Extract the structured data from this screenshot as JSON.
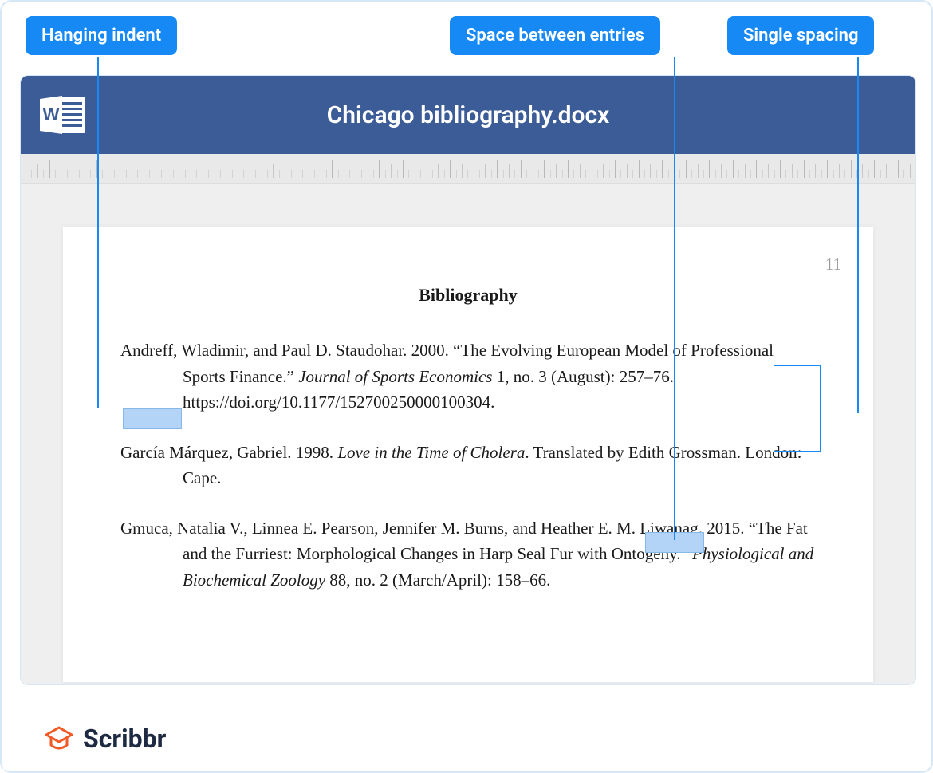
{
  "callouts": {
    "hanging_indent": "Hanging indent",
    "space_between": "Space between entries",
    "single_spacing": "Single spacing"
  },
  "document": {
    "filename": "Chicago bibliography.docx",
    "page_number": "11",
    "heading": "Bibliography",
    "entries": {
      "e1": {
        "p1": "Andreff, Wladimir, and Paul D. Staudohar. 2000. “The Evolving European Model of Professional Sports Finance.” ",
        "journal": "Journal of Sports Economics",
        "p2": " 1, no. 3 (August): 257–76. https://doi.org/10.1177/152700250000100304."
      },
      "e2": {
        "p1": "García Márquez, Gabriel. 1998. ",
        "title": "Love in the Time of Cholera",
        "p2": ". Translated by Edith Grossman. London: Cape."
      },
      "e3": {
        "p1": "Gmuca, Natalia V., Linnea E. Pearson, Jennifer M. Burns, and Heather E. M. Liwanag. 2015. “The Fat and the Furriest: Morphological Changes in Harp Seal Fur with Ontogeny.” ",
        "journal": "Physiological and Biochemical Zoology",
        "p2": " 88, no. 2 (March/April): 158–66."
      }
    }
  },
  "brand": "Scribbr"
}
